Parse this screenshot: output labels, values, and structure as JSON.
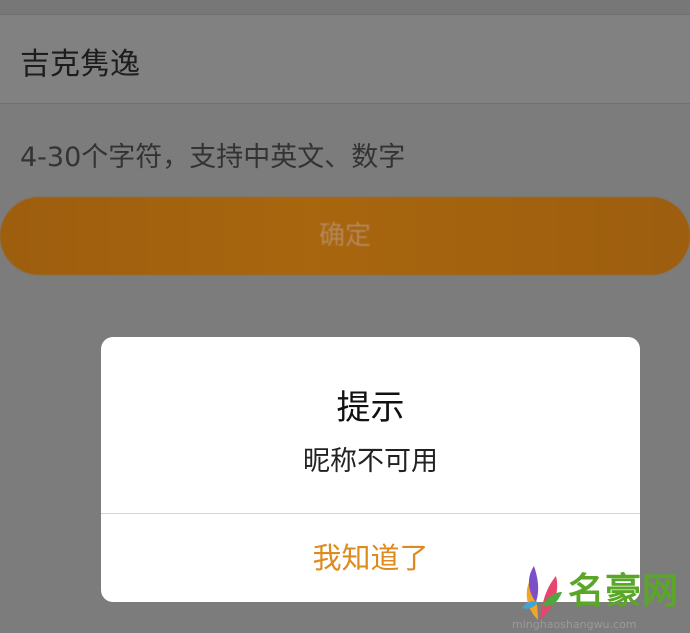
{
  "form": {
    "nickname_value": "吉克隽逸",
    "hint": "4-30个字符，支持中英文、数字",
    "confirm_label": "确定"
  },
  "dialog": {
    "title": "提示",
    "message": "昵称不可用",
    "button_label": "我知道了"
  },
  "watermark": {
    "name": "名豪网",
    "url": "minghaoshangwu.com"
  },
  "colors": {
    "overlay_background": "#7c7c7c",
    "confirm_button": "#a8660e",
    "dialog_button_text": "#dd8a1f",
    "watermark_green": "#5aa728"
  }
}
